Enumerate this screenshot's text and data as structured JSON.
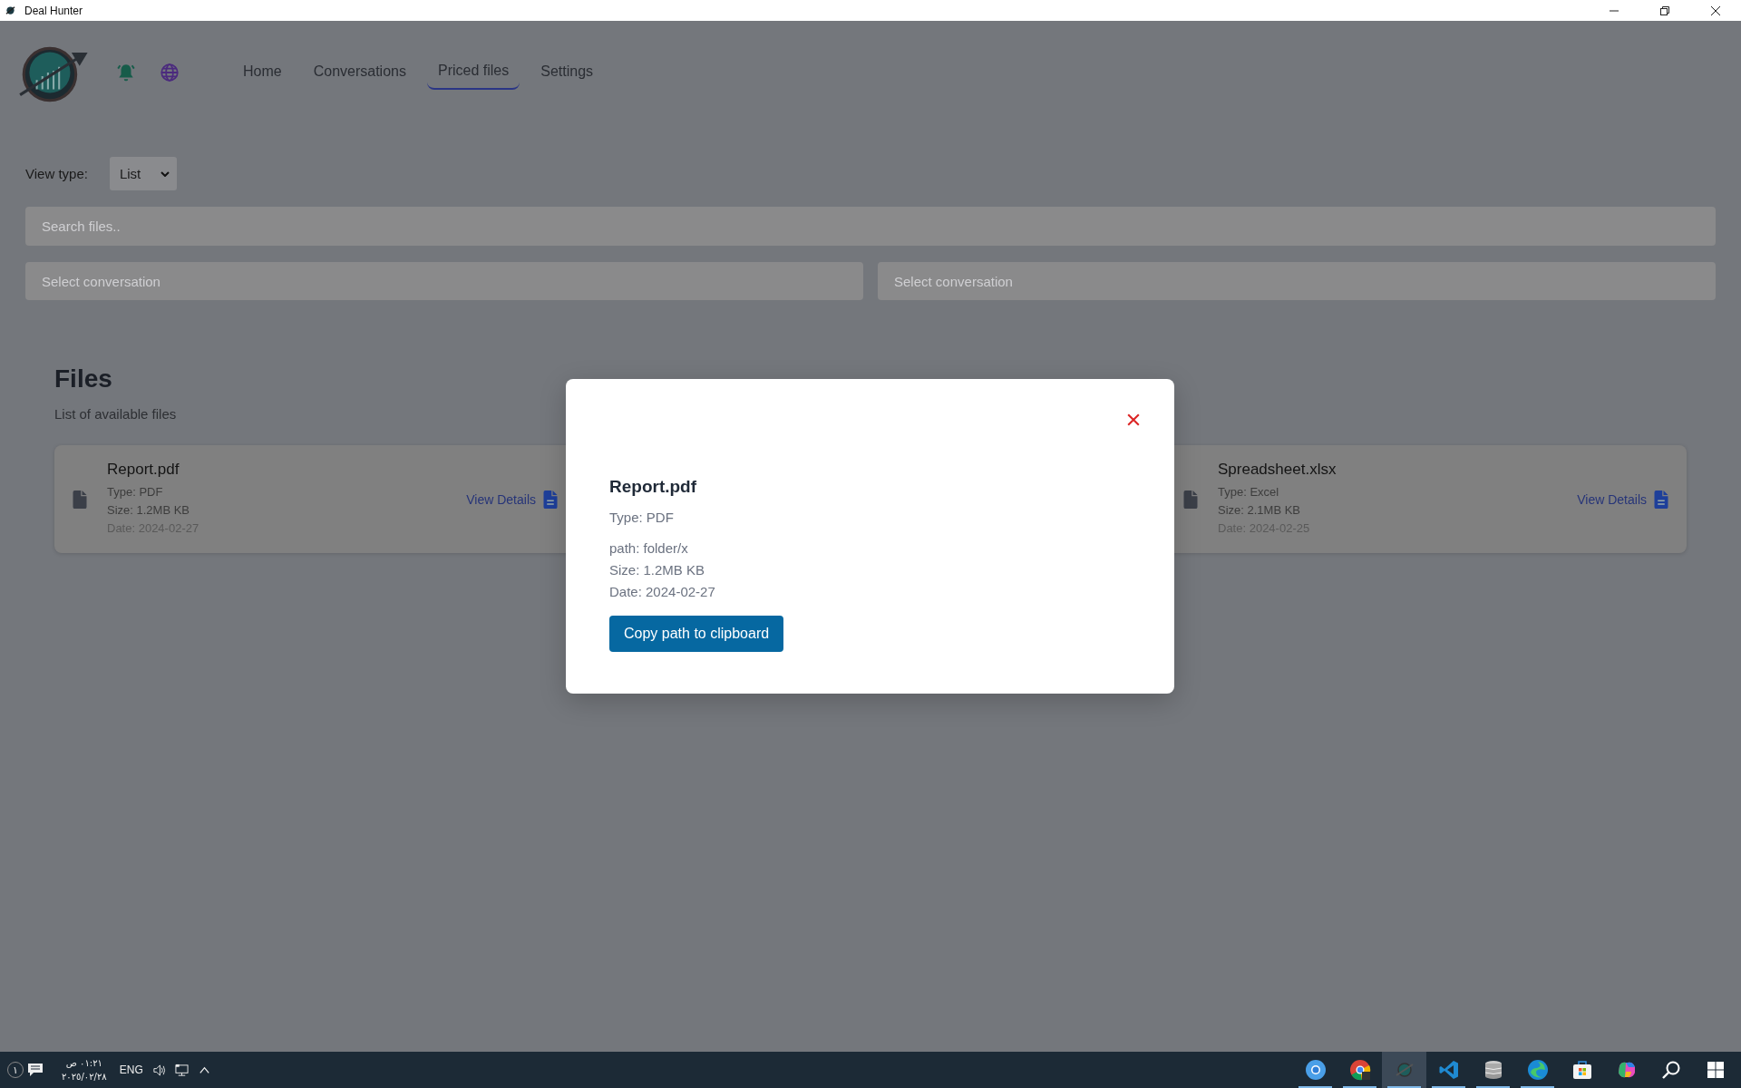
{
  "window": {
    "title": "Deal Hunter"
  },
  "nav": [
    {
      "label": "Home",
      "selected": false
    },
    {
      "label": "Conversations",
      "selected": false
    },
    {
      "label": "Priced files",
      "selected": true
    },
    {
      "label": "Settings",
      "selected": false
    }
  ],
  "view_type": {
    "label": "View type:",
    "value": "List"
  },
  "search": {
    "placeholder": "Search files.."
  },
  "conversation_filters": [
    {
      "placeholder": "Select conversation"
    },
    {
      "placeholder": "Select conversation"
    }
  ],
  "files": {
    "title": "Files",
    "subtitle": "List of available files",
    "cards": [
      {
        "name": "Report.pdf",
        "type": "Type: PDF",
        "size": "Size: 1.2MB KB",
        "date": "Date: 2024-02-27",
        "action": "View Details"
      },
      {
        "name": "Spreadsheet.xlsx",
        "type": "Type: Excel",
        "size": "Size: 2.1MB KB",
        "date": "Date: 2024-02-25",
        "action": "View Details"
      }
    ]
  },
  "modal": {
    "title": "Report.pdf",
    "type": "Type: PDF",
    "details": [
      "path: folder/x",
      "Size: 1.2MB KB",
      "Date: 2024-02-27"
    ],
    "button": "Copy path to clipboard"
  },
  "taskbar": {
    "notification_count": "١",
    "time": "٠١:٢١ ص",
    "date": "٢٠٢٥/٠٢/٢٨",
    "language": "ENG",
    "apps": [
      {
        "kind": "chromium",
        "running": true,
        "selected": false
      },
      {
        "kind": "chrome",
        "running": true,
        "selected": false
      },
      {
        "kind": "dealhunter",
        "running": true,
        "selected": true
      },
      {
        "kind": "vscode",
        "running": true,
        "selected": false
      },
      {
        "kind": "database",
        "running": true,
        "selected": false
      },
      {
        "kind": "edge",
        "running": true,
        "selected": false
      },
      {
        "kind": "store",
        "running": false,
        "selected": false
      },
      {
        "kind": "copilot",
        "running": false,
        "selected": false
      },
      {
        "kind": "search",
        "running": false,
        "selected": false
      },
      {
        "kind": "start",
        "running": false,
        "selected": false
      }
    ]
  }
}
